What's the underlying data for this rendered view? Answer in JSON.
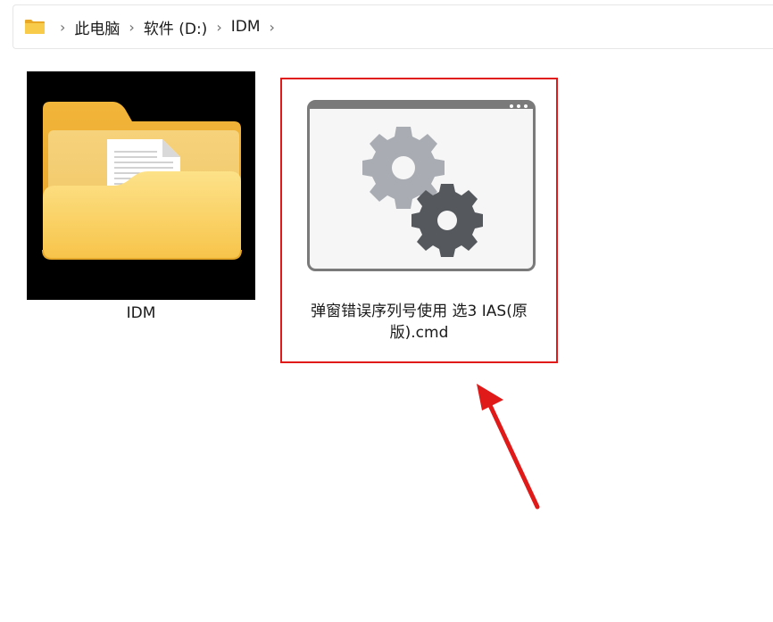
{
  "addressbar": {
    "icon": "folder-icon",
    "separator": "›",
    "crumbs": [
      "此电脑",
      "软件 (D:)",
      "IDM"
    ]
  },
  "items": [
    {
      "name": "IDM",
      "icon": "folder-with-document-icon"
    },
    {
      "name_line1": "弹窗错误序列号使用 选3 IAS(原",
      "name_line2": "版).cmd",
      "icon": "gears-window-icon",
      "highlighted": true
    }
  ],
  "colors": {
    "highlight": "#e01919",
    "arrow": "#e01919",
    "folder": "#f7c948"
  }
}
